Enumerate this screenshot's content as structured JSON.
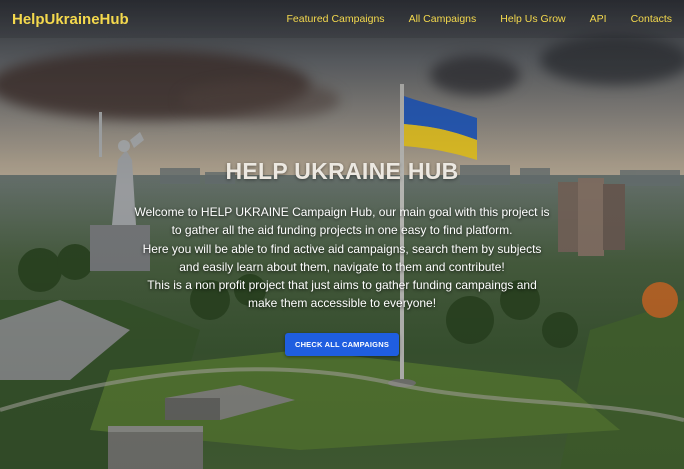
{
  "navbar": {
    "brand": "HelpUkraineHub",
    "links": [
      "Featured Campaigns",
      "All Campaigns",
      "Help Us Grow",
      "API",
      "Contacts"
    ]
  },
  "hero": {
    "title": "HELP UKRAINE HUB",
    "paragraphs": [
      "Welcome to HELP UKRAINE Campaign Hub, our main goal with this project is to gather all the aid funding projects in one easy to find platform.",
      "Here you will be able to find active aid campaigns, search them by subjects and easily learn about them, navigate to them and contribute!",
      "This is a non profit project that just aims to gather funding campaings and make them accessible to everyone!"
    ],
    "cta_label": "CHECK ALL CAMPAIGNS"
  },
  "colors": {
    "brand": "#f4d94d",
    "cta": "#1f5ee0",
    "flag_blue": "#2b63c7",
    "flag_yellow": "#f2cf2a"
  }
}
